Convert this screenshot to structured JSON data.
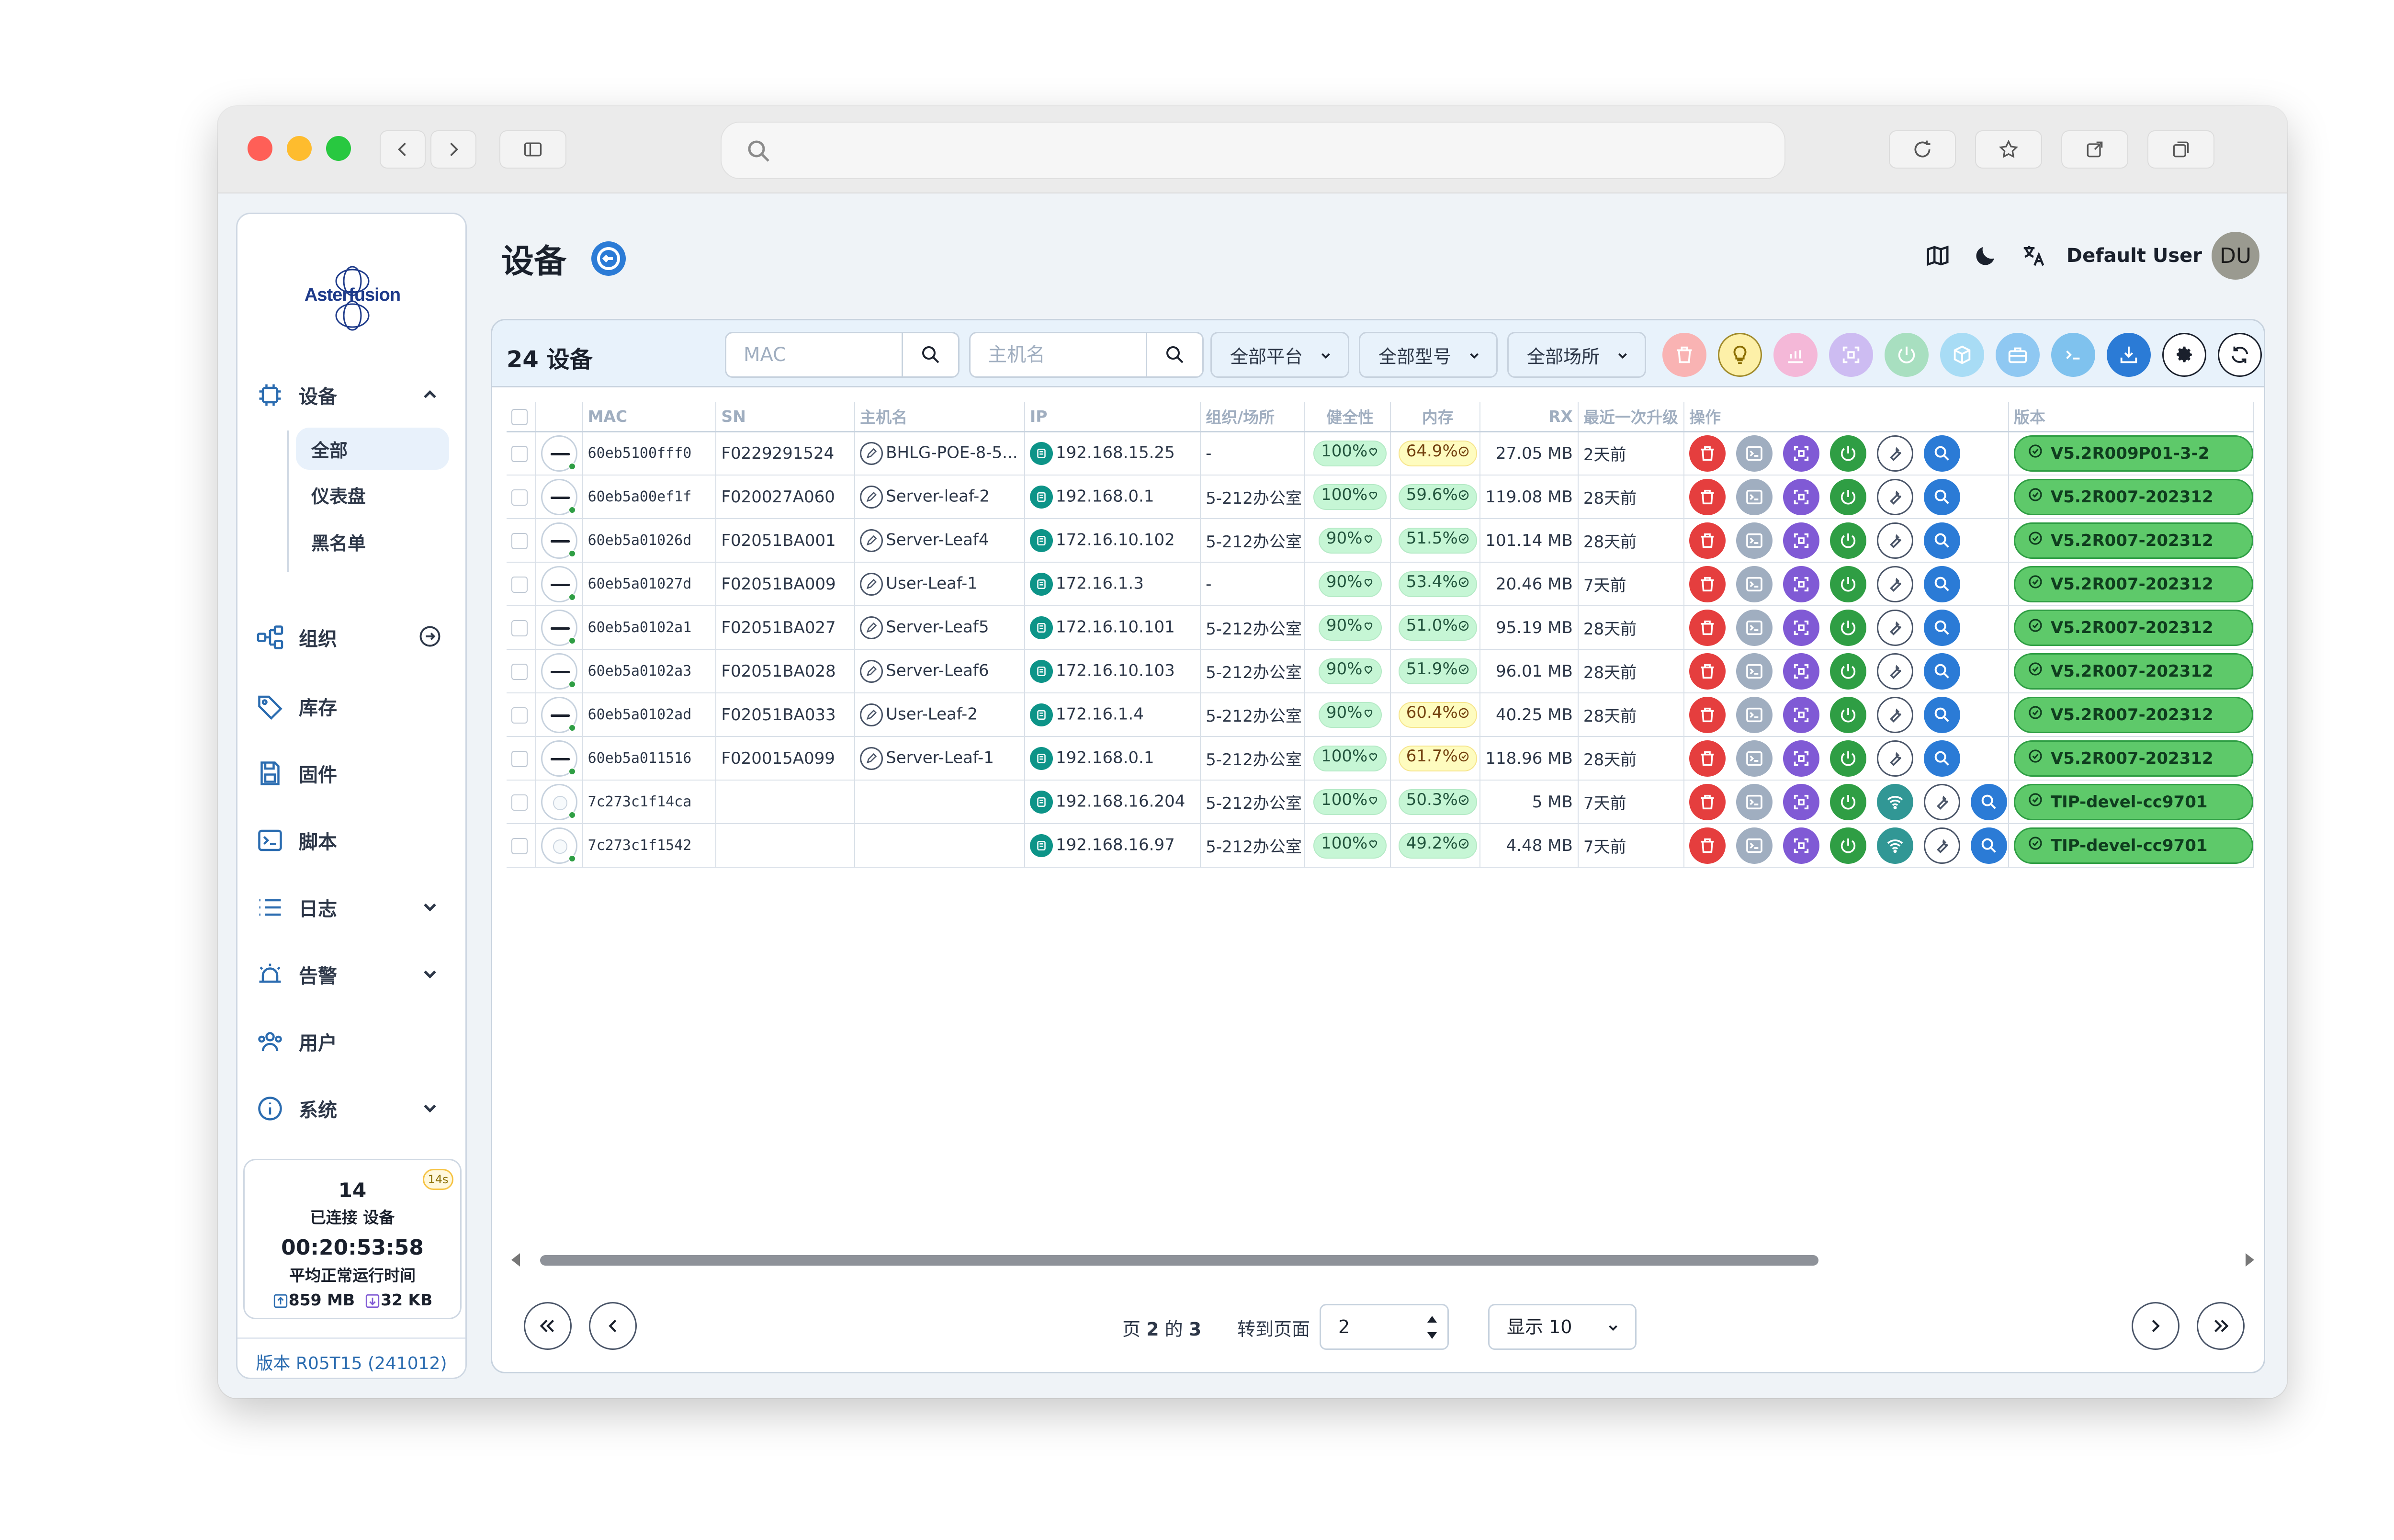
{
  "browser": {
    "url": ""
  },
  "brand": {
    "logo_text": "Asterfusion"
  },
  "sidebar": {
    "items": [
      {
        "label": "设备",
        "icon": "device-icon",
        "expanded": true
      },
      {
        "label": "组织",
        "icon": "org-icon"
      },
      {
        "label": "库存",
        "icon": "tag-icon"
      },
      {
        "label": "固件",
        "icon": "firmware-icon"
      },
      {
        "label": "脚本",
        "icon": "terminal-icon"
      },
      {
        "label": "日志",
        "icon": "list-icon"
      },
      {
        "label": "告警",
        "icon": "alarm-icon"
      },
      {
        "label": "用户",
        "icon": "users-icon"
      },
      {
        "label": "系统",
        "icon": "info-icon"
      }
    ],
    "device_sub": [
      "全部",
      "仪表盘",
      "黑名单"
    ],
    "stats": {
      "connected_count": "14",
      "connected_label": "已连接 设备",
      "uptime": "00:20:53:58",
      "uptime_label": "平均正常运行时间",
      "rx": "859 MB",
      "tx": "32 KB",
      "refresh_badge": "14s"
    },
    "version": "版本 R05T15 (241012)"
  },
  "header": {
    "title": "设备",
    "user_name": "Default User",
    "avatar_initials": "DU"
  },
  "toolbar": {
    "device_count": "24 设备",
    "mac_placeholder": "MAC",
    "hostname_placeholder": "主机名",
    "platform_filter": "全部平台",
    "model_filter": "全部型号",
    "venue_filter": "全部场所"
  },
  "table": {
    "columns": [
      "",
      "",
      "MAC",
      "SN",
      "主机名",
      "IP",
      "组织/场所",
      "健全性",
      "内存",
      "RX",
      "最近一次升级",
      "操作",
      "版本"
    ],
    "rows": [
      {
        "mac": "60eb5100fff0",
        "sn": "F0229291524",
        "host": "BHLG-POE-8-5...",
        "ip": "192.168.15.25",
        "venue": "-",
        "health": "100%",
        "mem": "64.9%",
        "mem_warn": true,
        "rx": "27.05 MB",
        "upgrade": "2天前",
        "version": "V5.2R009P01-3-2",
        "ap": false
      },
      {
        "mac": "60eb5a00ef1f",
        "sn": "F020027A060",
        "host": "Server-leaf-2",
        "ip": "192.168.0.1",
        "venue": "5-212办公室",
        "health": "100%",
        "mem": "59.6%",
        "mem_warn": false,
        "rx": "119.08 MB",
        "upgrade": "28天前",
        "version": "V5.2R007-202312",
        "ap": false
      },
      {
        "mac": "60eb5a01026d",
        "sn": "F02051BA001",
        "host": "Server-Leaf4",
        "ip": "172.16.10.102",
        "venue": "5-212办公室",
        "health": "90%",
        "mem": "51.5%",
        "mem_warn": false,
        "rx": "101.14 MB",
        "upgrade": "28天前",
        "version": "V5.2R007-202312",
        "ap": false
      },
      {
        "mac": "60eb5a01027d",
        "sn": "F02051BA009",
        "host": "User-Leaf-1",
        "ip": "172.16.1.3",
        "venue": "-",
        "health": "90%",
        "mem": "53.4%",
        "mem_warn": false,
        "rx": "20.46 MB",
        "upgrade": "7天前",
        "version": "V5.2R007-202312",
        "ap": false
      },
      {
        "mac": "60eb5a0102a1",
        "sn": "F02051BA027",
        "host": "Server-Leaf5",
        "ip": "172.16.10.101",
        "venue": "5-212办公室",
        "health": "90%",
        "mem": "51.0%",
        "mem_warn": false,
        "rx": "95.19 MB",
        "upgrade": "28天前",
        "version": "V5.2R007-202312",
        "ap": false
      },
      {
        "mac": "60eb5a0102a3",
        "sn": "F02051BA028",
        "host": "Server-Leaf6",
        "ip": "172.16.10.103",
        "venue": "5-212办公室",
        "health": "90%",
        "mem": "51.9%",
        "mem_warn": false,
        "rx": "96.01 MB",
        "upgrade": "28天前",
        "version": "V5.2R007-202312",
        "ap": false
      },
      {
        "mac": "60eb5a0102ad",
        "sn": "F02051BA033",
        "host": "User-Leaf-2",
        "ip": "172.16.1.4",
        "venue": "5-212办公室",
        "health": "90%",
        "mem": "60.4%",
        "mem_warn": true,
        "rx": "40.25 MB",
        "upgrade": "28天前",
        "version": "V5.2R007-202312",
        "ap": false
      },
      {
        "mac": "60eb5a011516",
        "sn": "F020015A099",
        "host": "Server-Leaf-1",
        "ip": "192.168.0.1",
        "venue": "5-212办公室",
        "health": "100%",
        "mem": "61.7%",
        "mem_warn": true,
        "rx": "118.96 MB",
        "upgrade": "28天前",
        "version": "V5.2R007-202312",
        "ap": false
      },
      {
        "mac": "7c273c1f14ca",
        "sn": "",
        "host": "",
        "ip": "192.168.16.204",
        "venue": "5-212办公室",
        "health": "100%",
        "mem": "50.3%",
        "mem_warn": false,
        "rx": "5 MB",
        "upgrade": "7天前",
        "version": "TIP-devel-cc9701",
        "ap": true
      },
      {
        "mac": "7c273c1f1542",
        "sn": "",
        "host": "",
        "ip": "192.168.16.97",
        "venue": "5-212办公室",
        "health": "100%",
        "mem": "49.2%",
        "mem_warn": false,
        "rx": "4.48 MB",
        "upgrade": "7天前",
        "version": "TIP-devel-cc9701",
        "ap": true
      }
    ]
  },
  "pagination": {
    "page_prefix": "页",
    "page_current": "2",
    "page_of": "的",
    "page_total": "3",
    "goto_label": "转到页面",
    "goto_value": "2",
    "page_size": "显示 10"
  },
  "colors": {
    "accent": "#2b7bd6",
    "version_pill": "#5ec96a",
    "delete": "#e53e3e",
    "power": "#2f9e44"
  }
}
